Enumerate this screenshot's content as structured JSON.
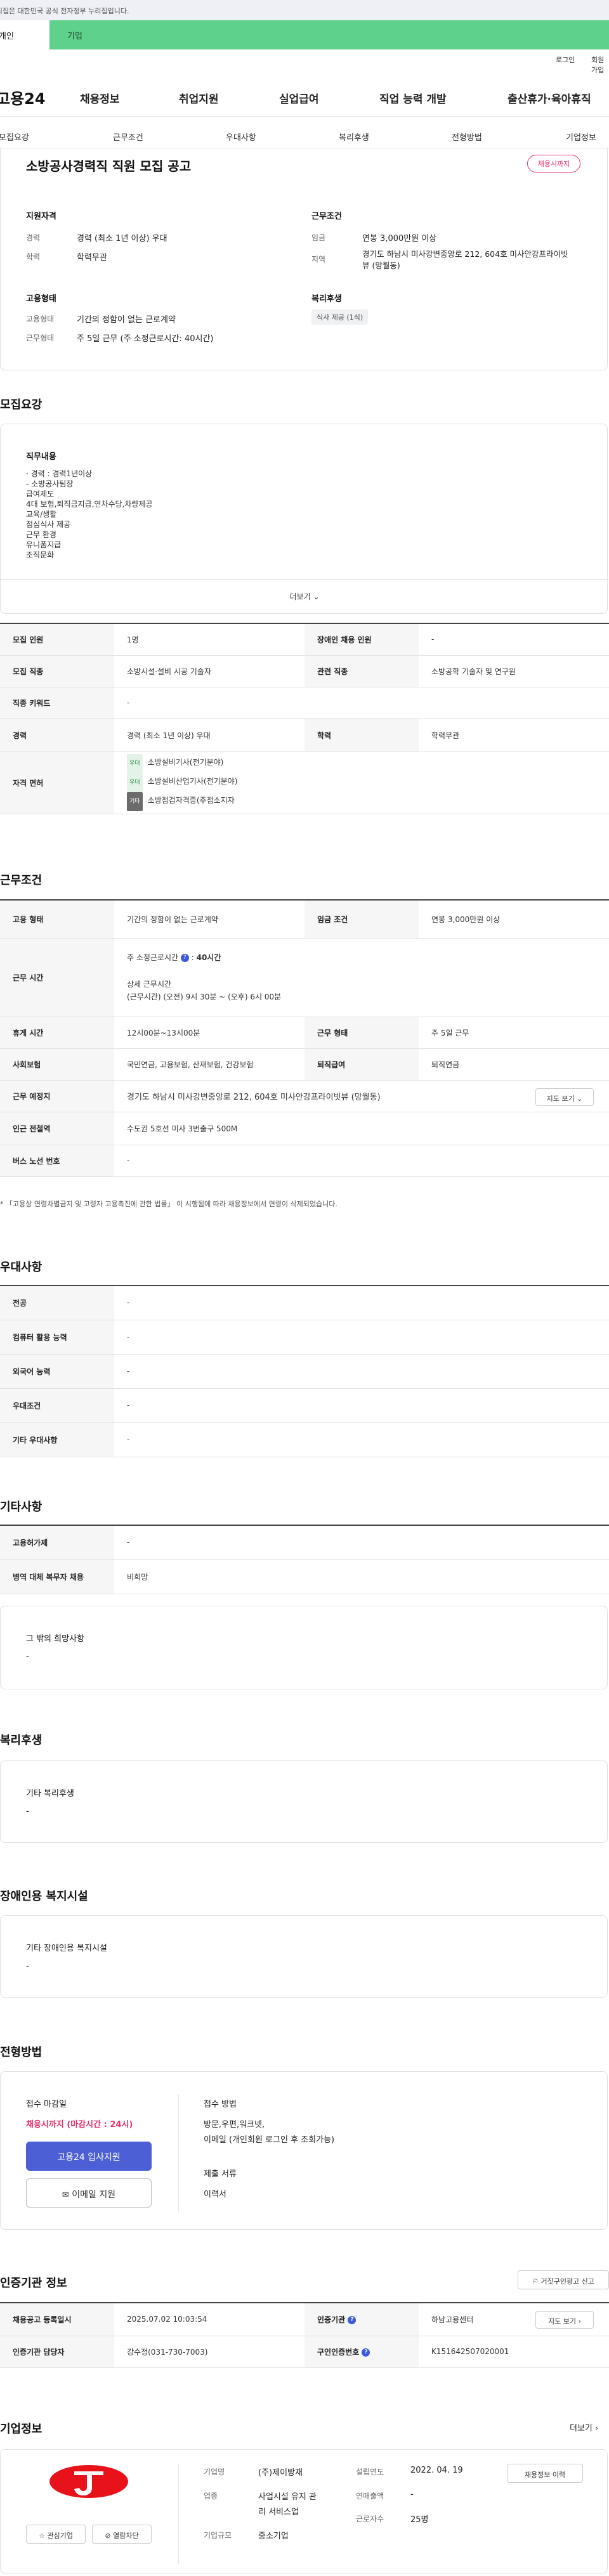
{
  "gov_banner": {
    "text": "이 누리집은 대한민국 공식 전자정부 누리집입니다."
  },
  "top_tabs": {
    "individual": "개인",
    "company": "기업"
  },
  "util": {
    "login": "로그인",
    "join": "회원가입"
  },
  "brand": {
    "logo": "고용24"
  },
  "gnb": [
    "채용정보",
    "취업지원",
    "실업급여",
    "직업 능력 개발",
    "출산휴가·육아휴직"
  ],
  "subnav": [
    "모집요강",
    "근무조건",
    "우대사항",
    "복리후생",
    "전형방법",
    "기업정보"
  ],
  "summary": {
    "title": "소방공사경력직 직원 모집 공고",
    "badge": "채용시까지",
    "qual_title": "지원자격",
    "cond_title": "근무조건",
    "career_k": "경력",
    "career_v": "경력 (최소 1년 이상) 우대",
    "edu_k": "학력",
    "edu_v": "학력무관",
    "wage_k": "임금",
    "wage_v": "연봉 3,000만원 이상",
    "area_k": "지역",
    "area_v": "경기도 하남시 미사강변중앙로 212, 604호 미사안강프라이빗뷰 (망월동)",
    "emp_title": "고용형태",
    "welfare_title": "복리후생",
    "emptype_k": "고용형태",
    "emptype_v": "기간의 정함이 없는 근로계약",
    "worktype_k": "근무형태",
    "worktype_v": "주 5일 근무 (주 소정근로시간: 40시간)",
    "welfare_chip": "식사 제공 (1식)"
  },
  "recruit": {
    "section": "모집요강",
    "duty_title": "직무내용",
    "duty_lines": [
      "· 경력 : 경력1년이상",
      "- 소방공사팀장",
      "급여제도",
      "4대 보험,퇴직금지급,연차수당,차량제공",
      "교육/생활",
      "점심식사 제공",
      "근무 환경",
      "유니폼지급",
      "조직문화"
    ],
    "more": "더보기",
    "rows": {
      "r1_k": "모집 인원",
      "r1_v": "1명",
      "r1_k2": "장애인 채용 인원",
      "r1_v2": "-",
      "r2_k": "모집 직종",
      "r2_v": "소방시설·설비 시공 기술자",
      "r2_k2": "관련 직종",
      "r2_v2": "소방공학 기술자 및 연구원",
      "r3_k": "직종 키워드",
      "r3_v": "-",
      "r4_k": "경력",
      "r4_v": "경력 (최소 1년 이상) 우대",
      "r4_k2": "학력",
      "r4_v2": "학력무관",
      "r5_k": "자격 면허"
    },
    "licenses": [
      {
        "tag": "우대",
        "name": "소방설비기사(전기분야)"
      },
      {
        "tag": "우대",
        "name": "소방설비산업기사(전기분야)"
      },
      {
        "tag": "기타",
        "name": "소방점검자격증(주점소지자"
      }
    ]
  },
  "conditions": {
    "section": "근무조건",
    "emp_k": "고용 형태",
    "emp_v": "기간의 정함이 없는 근로계약",
    "wage_k": "임금 조건",
    "wage_v": "연봉 3,000만원 이상",
    "time_k": "근무 시간",
    "time_main": "주 소정근로시간",
    "time_hours": "40시간",
    "time_detail_t": "상세 근무시간",
    "time_detail_v": "(근무시간) (오전) 9시 30분 ~ (오후) 6시 00분",
    "rest_k": "휴게 시간",
    "rest_v": "12시00분~13시00분",
    "form_k": "근무 형태",
    "form_v": "주 5일 근무",
    "ins_k": "사회보험",
    "ins_v": "국민연금, 고용보험, 산재보험, 건강보험",
    "ret_k": "퇴직급여",
    "ret_v": "퇴직연금",
    "place_k": "근무 예정지",
    "place_v": "경기도 하남시 미사강변중앙로 212, 604호 미사안강프라이빗뷰 (망월동)",
    "map_btn": "지도 보기",
    "subway_k": "인근 전철역",
    "subway_v": "수도권 5호선 미사 3번출구 500M",
    "bus_k": "버스 노선 번호",
    "bus_v": "-",
    "notice": "* 「고용상 연령차별금지 및 고령자 고용촉진에 관한 법률」 이 시행됨에 따라 채용정보에서 연령이 삭제되었습니다."
  },
  "pref": {
    "section": "우대사항",
    "rows": [
      {
        "k": "전공",
        "v": "-"
      },
      {
        "k": "컴퓨터 활용 능력",
        "v": "-"
      },
      {
        "k": "외국어 능력",
        "v": "-"
      },
      {
        "k": "우대조건",
        "v": "-"
      },
      {
        "k": "기타 우대사항",
        "v": "-"
      }
    ]
  },
  "etc": {
    "section": "기타사항",
    "rows": [
      {
        "k": "고용허가제",
        "v": "-"
      },
      {
        "k": "병역 대체 복무자 채용",
        "v": "비희망"
      }
    ],
    "other_t": "그 밖의 희망사항",
    "other_v": "-"
  },
  "welfare": {
    "section": "복리후생",
    "t": "기타 복리후생",
    "v": "-"
  },
  "disability": {
    "section": "장애인용 복지시설",
    "t": "기타 장애인용 복지시설",
    "v": "-"
  },
  "apply": {
    "section": "전형방법",
    "deadline_t": "접수 마감일",
    "deadline_v": "채용시까지 (마감시간 : 24시)",
    "btn_apply": "고용24 입사지원",
    "btn_email": "이메일 지원",
    "method_t": "접수 방법",
    "method_v1": "방문,우편,워크넷,",
    "method_v2": "이메일 (개인회원 로그인 후 조회가능)",
    "docs_t": "제출 서류",
    "docs_v": "이력서"
  },
  "cert": {
    "section": "인증기관 정보",
    "report_btn": "거짓구인광고 신고",
    "reg_k": "채용공고 등록일시",
    "reg_v": "2025.07.02 10:03:54",
    "org_k": "인증기관",
    "org_v": "하남고용센터",
    "map_btn": "지도 보기",
    "mgr_k": "인증기관 담당자",
    "mgr_v": "강수정(031-730-7003)",
    "no_k": "구인인증번호",
    "no_v": "K151642507020001"
  },
  "company": {
    "section": "기업정보",
    "more": "더보기",
    "name_k": "기업명",
    "name_v": "(주)제이방재",
    "est_k": "설립연도",
    "est_v": "2022. 04. 19",
    "biz_k": "업종",
    "biz_v1": "사업시설 유지 관",
    "biz_v2": "리 서비스업",
    "sales_k": "연매출액",
    "sales_v": "-",
    "emp_k": "근로자수",
    "emp_v": "25명",
    "size_k": "기업규모",
    "size_v": "중소기업",
    "history_btn": "채용정보 이력",
    "fav_btn": "관심기업",
    "block_btn": "열람차단"
  },
  "colors": {
    "accent": "#4c5fd5",
    "green": "#5ed28c",
    "red": "#e6316a"
  }
}
